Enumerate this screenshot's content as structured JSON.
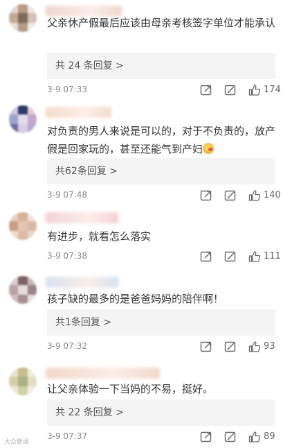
{
  "comments": [
    {
      "text": "父亲休产假最后应该由母亲考核签字单位才能承认",
      "replies": "共 24 条回复 >",
      "time": "3-9 07:33",
      "likes": "174",
      "avatar_colors": [
        "#e2d6cc",
        "#b89a86",
        "#efe5dc",
        "#c4a894",
        "#7d6a5b",
        "#d3c2b4",
        "#e8ddd3",
        "#b39b88",
        "#f2ebe4"
      ],
      "name_color": "#f0d7d0"
    },
    {
      "text": "对负责的男人来说是可以的，对于不负责的，放产假是回家玩的，甚至还能气到产妇",
      "replies": "共62条回复 >",
      "time": "3-9 07:48",
      "likes": "140",
      "avatar_colors": [
        "#cfc6e0",
        "#2d3a6a",
        "#e8c9d8",
        "#9fa3c9",
        "#e2dbe9",
        "#c1a8c8",
        "#6d6f9f",
        "#d7cde6",
        "#b7a9d2"
      ],
      "name_color": "#f7dcc9"
    },
    {
      "text": "有进步，就看怎么落实",
      "replies": "",
      "time": "3-9 07:38",
      "likes": "111",
      "avatar_colors": [
        "#e9cfc0",
        "#d6b29c",
        "#f3e3d8",
        "#c8a088",
        "#e6c4b0",
        "#d9b8a6",
        "#f1ddd0",
        "#ddbba6",
        "#efd8ca"
      ],
      "name_color": "#f4d1d5"
    },
    {
      "text": "孩子缺的最多的是爸爸妈妈的陪伴啊！",
      "replies": "共1条回复 >",
      "time": "3-9 07:32",
      "likes": "93",
      "avatar_colors": [
        "#d9cfd1",
        "#7b6467",
        "#cab8bb",
        "#b9a3a6",
        "#e4dcdd",
        "#9a8488",
        "#cdbfc1",
        "#a88f93",
        "#e7e0e1"
      ],
      "name_color": "#d7e3f1"
    },
    {
      "text": "让父亲体验一下当妈的不易，挺好。",
      "replies": "共 22 条回复 >",
      "time": "3-9 07:37",
      "likes": "89",
      "avatar_colors": [
        "#e7e2cf",
        "#c9bd8f",
        "#eef0e0",
        "#d7cfa6",
        "#a9b184",
        "#e3dec3",
        "#efe9d7",
        "#cfd2a8",
        "#f2efe1"
      ],
      "name_color": "#f2d8c8"
    }
  ],
  "watermark": "大众新闻"
}
